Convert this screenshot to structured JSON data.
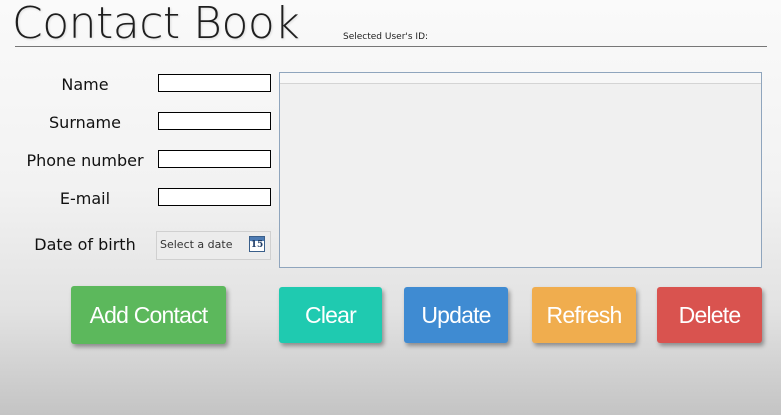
{
  "app": {
    "title": "Contact Book",
    "selected_user_label": "Selected User's ID:"
  },
  "form": {
    "name_label": "Name",
    "surname_label": "Surname",
    "phone_label": "Phone number",
    "email_label": "E-mail",
    "dob_label": "Date of birth",
    "name_value": "",
    "surname_value": "",
    "phone_value": "",
    "email_value": "",
    "dob_placeholder": "Select a date",
    "calendar_day": "15",
    "calendar_icon": "calendar-icon"
  },
  "contacts_table": {
    "rows": []
  },
  "buttons": {
    "add": {
      "label": "Add Contact",
      "color": "#5cb85c"
    },
    "clear": {
      "label": "Clear",
      "color": "#1fcab0"
    },
    "update": {
      "label": "Update",
      "color": "#3f8bd2"
    },
    "refresh": {
      "label": "Refresh",
      "color": "#f0ad4e"
    },
    "delete": {
      "label": "Delete",
      "color": "#d9534f"
    }
  }
}
